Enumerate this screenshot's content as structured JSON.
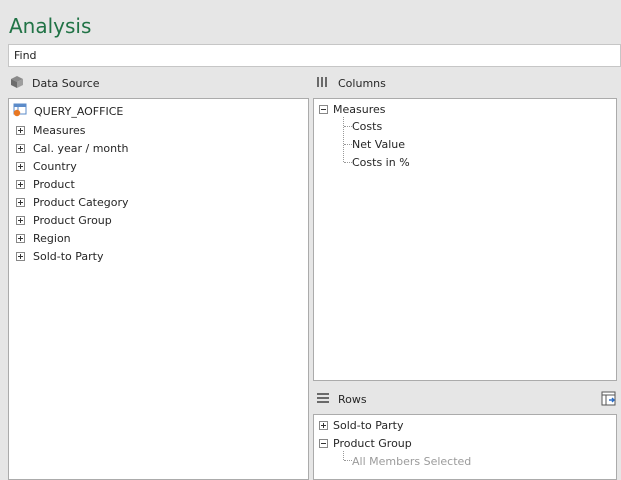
{
  "window": {
    "title": "Analysis"
  },
  "search": {
    "value": "Find"
  },
  "data_source": {
    "header": "Data Source",
    "query": "QUERY_AOFFICE",
    "items": [
      {
        "label": "Measures"
      },
      {
        "label": "Cal. year / month"
      },
      {
        "label": "Country"
      },
      {
        "label": "Product"
      },
      {
        "label": "Product Category"
      },
      {
        "label": "Product Group"
      },
      {
        "label": "Region"
      },
      {
        "label": "Sold-to Party"
      }
    ]
  },
  "columns": {
    "header": "Columns",
    "root": "Measures",
    "children": [
      "Costs",
      "Net Value",
      "Costs in %"
    ]
  },
  "rows": {
    "header": "Rows",
    "items": [
      {
        "label": "Sold-to Party"
      },
      {
        "label": "Product Group",
        "children": [
          "All Members Selected"
        ]
      }
    ]
  },
  "icons": {
    "data_source": "cube-icon",
    "columns": "columns-icon",
    "rows": "rows-icon",
    "query": "query-icon",
    "filter": "filter-settings-icon"
  },
  "colors": {
    "accent": "#217346",
    "background": "#e6e6e6"
  }
}
